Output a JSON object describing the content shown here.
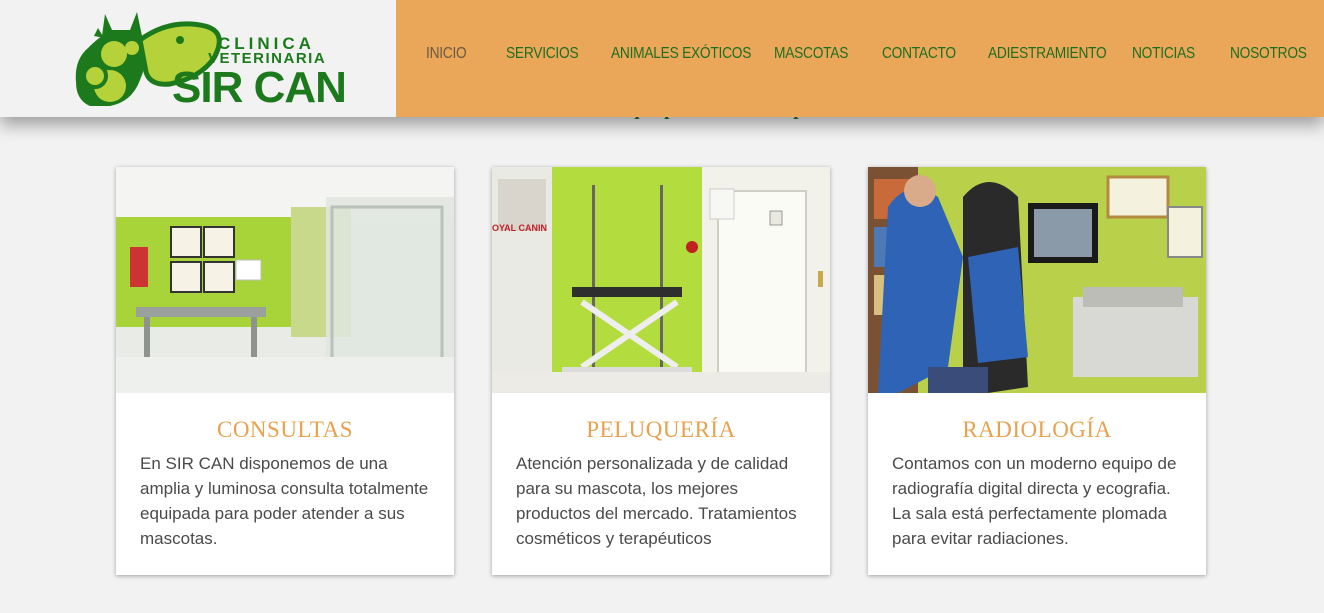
{
  "header": {
    "logo": {
      "line1": "CLINICA",
      "line2": "VETERINARIA",
      "line3": "SIR CAN"
    },
    "nav": [
      {
        "label": "INICIO"
      },
      {
        "label": "SERVICIOS"
      },
      {
        "label": "ANIMALES EXÓTICOS"
      },
      {
        "label": "MASCOTAS"
      },
      {
        "label": "CONTACTO"
      },
      {
        "label": "ADIESTRAMIENTO"
      },
      {
        "label": "NOTICIAS"
      },
      {
        "label": "NOSOTROS"
      }
    ]
  },
  "peek_text": "Descubre todo lo que podemos hacer por ti",
  "cards": [
    {
      "title": "CONSULTAS",
      "text": "En SIR CAN disponemos de una amplia y luminosa consulta totalmente equipada para poder atender a sus mascotas."
    },
    {
      "title": "PELUQUERÍA",
      "text": "Atención personalizada y de calidad para su mascota, los mejores productos del mercado. Tratamientos cosméticos y terapéuticos"
    },
    {
      "title": "RADIOLOGÍA",
      "text": "Contamos con un moderno equipo de radiografía digital directa y ecografia. La sala está perfectamente plomada para evitar radiaciones."
    }
  ],
  "photo_signs": {
    "royal_canin": "OYAL CANIN"
  },
  "colors": {
    "nav_bg": "#eaa75a",
    "brand_green": "#1c7a1c",
    "title_orange": "#e8a24f"
  }
}
